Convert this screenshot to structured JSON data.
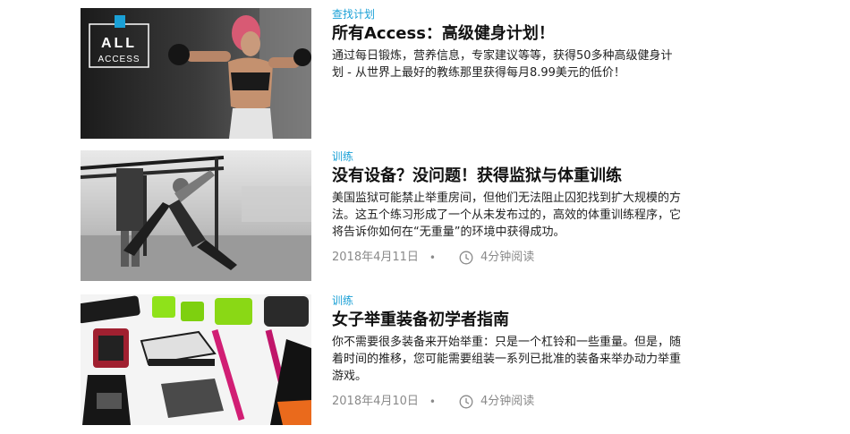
{
  "articles": [
    {
      "category": "查找计划",
      "title": "所有Access：高级健身计划！",
      "excerpt": "通过每日锻炼，营养信息，专家建议等等，获得50多种高级健身计划 - 从世界上最好的教练那里获得每月8.99美元的低价！",
      "thumb_label_top": "ALL",
      "thumb_label_bottom": "ACCESS",
      "date": "",
      "read_time": ""
    },
    {
      "category": "训练",
      "title": "没有设备？没问题！获得监狱与体重训练",
      "excerpt": "美国监狱可能禁止举重房间，但他们无法阻止囚犯找到扩大规模的方法。这五个练习形成了一个从未发布过的，高效的体重训练程序，它将告诉你如何在“无重量”的环境中获得成功。",
      "date": "2018年4月11日",
      "dot": "•",
      "read_time": "4分钟阅读"
    },
    {
      "category": "训练",
      "title": "女子举重装备初学者指南",
      "excerpt": "你不需要很多装备来开始举重：只是一个杠铃和一些重量。但是，随着时间的推移，您可能需要组装一系列已批准的装备来举办动力举重游戏。",
      "date": "2018年4月10日",
      "dot": "•",
      "read_time": "4分钟阅读"
    }
  ],
  "colors": {
    "category": "#1aa0d6",
    "meta": "#8a8a8a",
    "title": "#111111"
  }
}
